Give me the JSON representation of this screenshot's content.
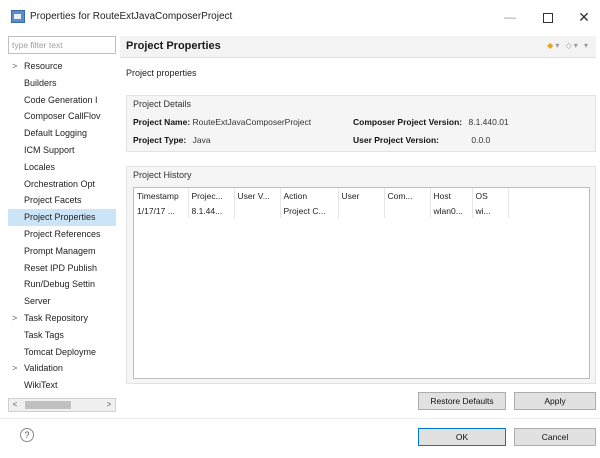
{
  "window": {
    "title": "Properties for RouteExtJavaComposerProject",
    "minimize": "—",
    "close": "✕"
  },
  "sidebar": {
    "filter_placeholder": "type filter text",
    "items": [
      {
        "label": "Resource",
        "expandable": true
      },
      {
        "label": "Builders",
        "expandable": false
      },
      {
        "label": "Code Generation I",
        "expandable": false
      },
      {
        "label": "Composer CallFlov",
        "expandable": false
      },
      {
        "label": "Default Logging",
        "expandable": false
      },
      {
        "label": "ICM Support",
        "expandable": false
      },
      {
        "label": "Locales",
        "expandable": false
      },
      {
        "label": "Orchestration Opt",
        "expandable": false
      },
      {
        "label": "Project Facets",
        "expandable": false
      },
      {
        "label": "Project Properties",
        "expandable": false,
        "selected": true
      },
      {
        "label": "Project References",
        "expandable": false
      },
      {
        "label": "Prompt Managem",
        "expandable": false
      },
      {
        "label": "Reset IPD Publish",
        "expandable": false
      },
      {
        "label": "Run/Debug Settin",
        "expandable": false
      },
      {
        "label": "Server",
        "expandable": false
      },
      {
        "label": "Task Repository",
        "expandable": true
      },
      {
        "label": "Task Tags",
        "expandable": false
      },
      {
        "label": "Tomcat Deployme",
        "expandable": false
      },
      {
        "label": "Validation",
        "expandable": true
      },
      {
        "label": "WikiText",
        "expandable": false
      }
    ]
  },
  "main": {
    "title": "Project Properties",
    "subtitle": "Project properties",
    "details": {
      "section_title": "Project Details",
      "project_name_label": "Project Name:",
      "project_name_value": "RouteExtJavaComposerProject",
      "composer_version_label": "Composer Project Version:",
      "composer_version_value": "8.1.440.01",
      "project_type_label": "Project Type:",
      "project_type_value": "Java",
      "user_version_label": "User Project Version:",
      "user_version_value": "0.0.0"
    },
    "history": {
      "section_title": "Project History",
      "columns": [
        "Timestamp",
        "Projec...",
        "User V...",
        "Action",
        "User",
        "Com...",
        "Host",
        "OS"
      ],
      "rows": [
        [
          "1/17/17 ...",
          "8.1.44...",
          "",
          "Project C...",
          "",
          "",
          "wlan0...",
          "wi..."
        ]
      ]
    }
  },
  "buttons": {
    "restore_defaults": "Restore Defaults",
    "apply": "Apply",
    "ok": "OK",
    "cancel": "Cancel",
    "help": "?"
  },
  "colors": {
    "selection": "#cce4f7",
    "primary_border": "#0078d7"
  }
}
